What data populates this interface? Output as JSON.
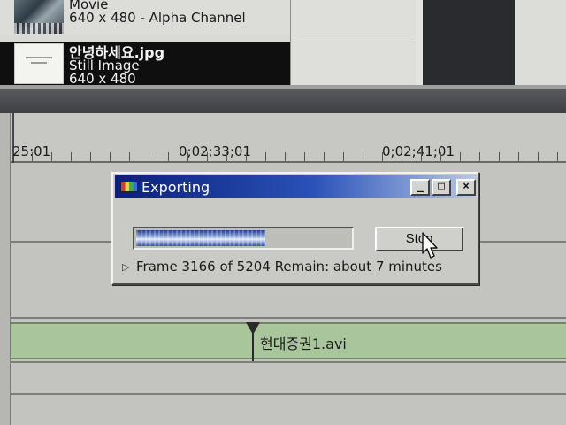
{
  "project_bin": {
    "items": [
      {
        "name": "Movie",
        "details": "640 x 480 - Alpha Channel",
        "selected": false
      },
      {
        "name": "안녕하세요.jpg",
        "type": "Still Image",
        "dims": "640 x 480",
        "selected": true
      }
    ]
  },
  "timeline": {
    "ruler_timecodes": [
      "25:01",
      "0;02;33;01",
      "0;02;41;01"
    ],
    "clip": {
      "name": "현대증권1.avi",
      "color": "#a8c59c"
    }
  },
  "export_dialog": {
    "title": "Exporting",
    "window_buttons": {
      "minimize": "_",
      "maximize": "□",
      "close": "×"
    },
    "progress_fraction": 0.6084,
    "stop_label": "Stop",
    "status": "Frame 3166 of 5204 Remain: about 7 minutes",
    "status_icon": "play-triangle-icon"
  },
  "colors": {
    "title_gradient_start": "#0a1f7a",
    "progress_fill": "#2c4ea8",
    "clip_green": "#a8c59c"
  }
}
